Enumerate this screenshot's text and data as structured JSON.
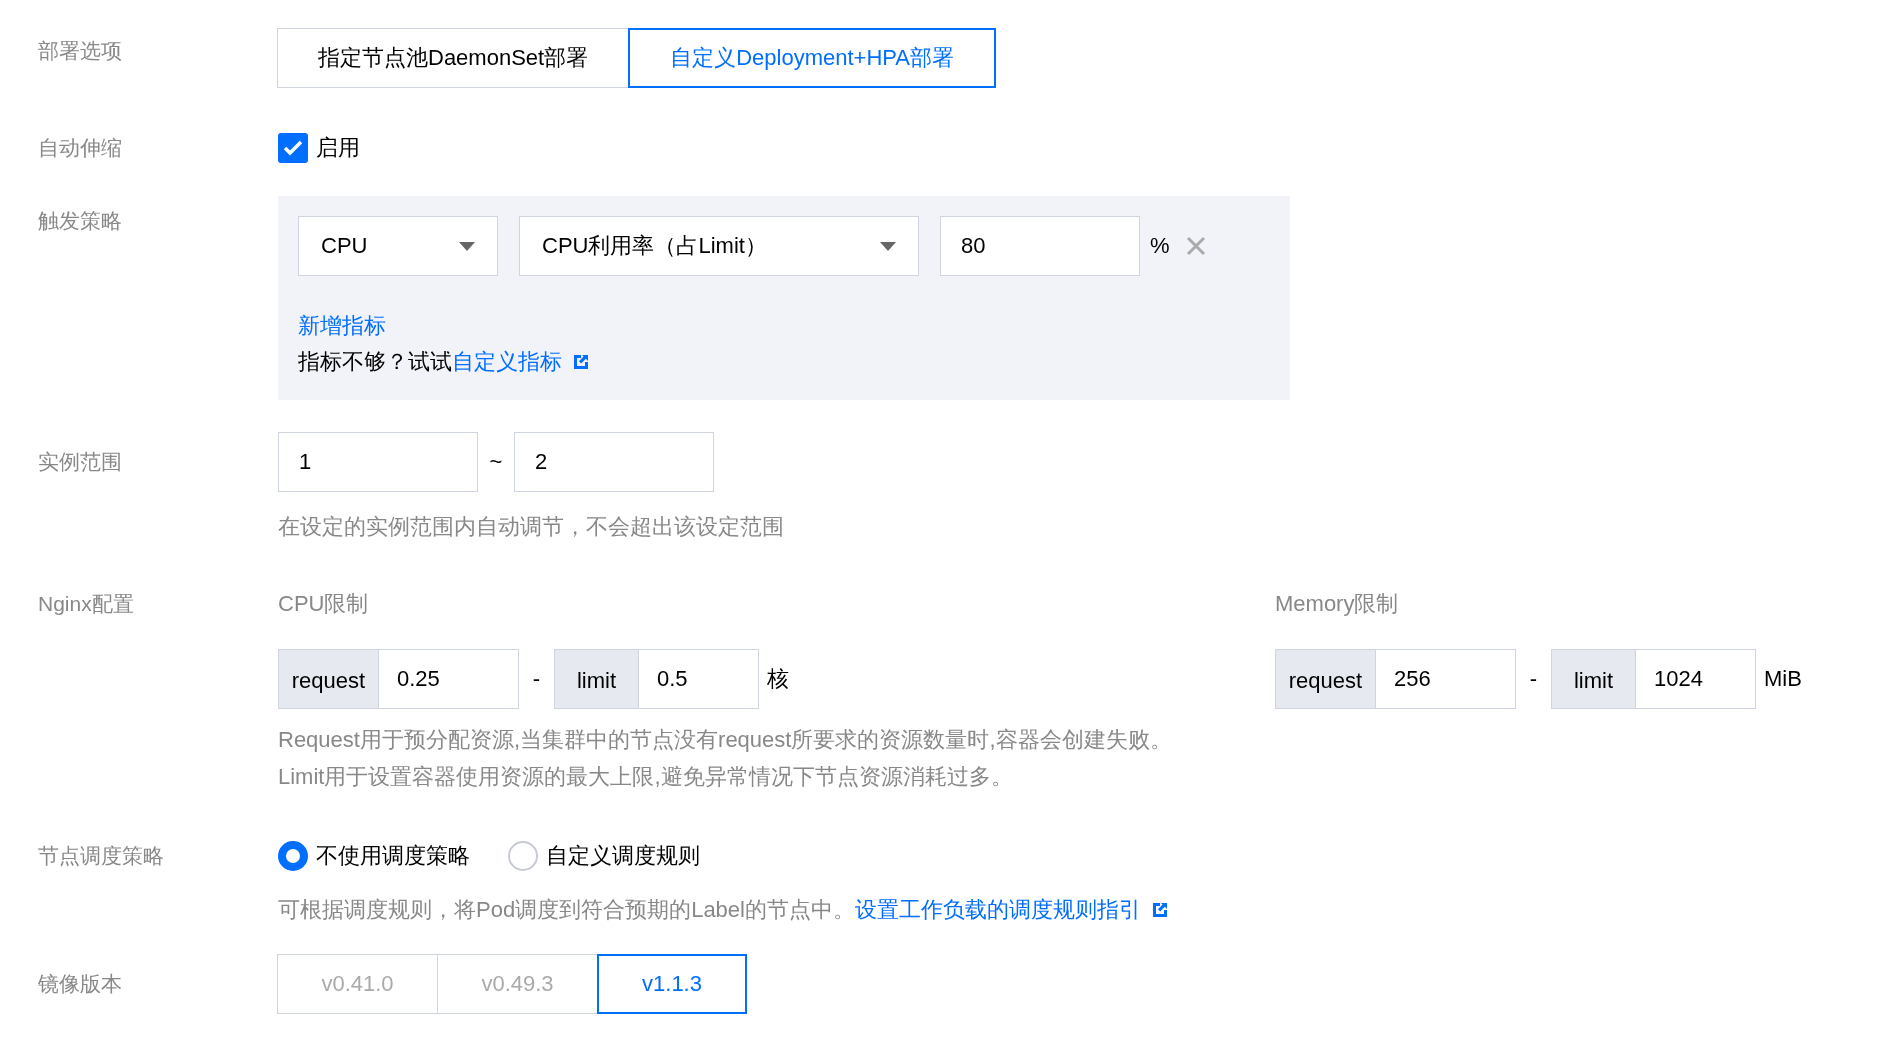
{
  "deploy_option": {
    "label": "部署选项",
    "options": [
      {
        "label": "指定节点池DaemonSet部署",
        "selected": false
      },
      {
        "label": "自定义Deployment+HPA部署",
        "selected": true
      }
    ]
  },
  "autoscaling": {
    "label": "自动伸缩",
    "checkbox": {
      "label": "启用",
      "checked": true
    }
  },
  "trigger_policy": {
    "label": "触发策略",
    "metric_type": {
      "value": "CPU"
    },
    "metric": {
      "value": "CPU利用率（占Limit）"
    },
    "threshold": {
      "value": "80"
    },
    "unit": "%",
    "add_link": "新增指标",
    "hint": "指标不够？试试",
    "hint_link": "自定义指标"
  },
  "instance_range": {
    "label": "实例范围",
    "min": {
      "value": "1"
    },
    "separator": "~",
    "max": {
      "value": "2"
    },
    "hint": "在设定的实例范围内自动调节，不会超出该设定范围"
  },
  "nginx_config": {
    "label": "Nginx配置",
    "groups": [
      {
        "title": "CPU限制",
        "request_label": "request",
        "request": "0.25",
        "separator": "-",
        "limit_label": "limit",
        "limit": "0.5",
        "unit": "核"
      },
      {
        "title": "Memory限制",
        "request_label": "request",
        "request": "256",
        "separator": "-",
        "limit_label": "limit",
        "limit": "1024",
        "unit": "MiB"
      }
    ],
    "hint_lines": [
      "Request用于预分配资源,当集群中的节点没有request所要求的资源数量时,容器会创建失败。",
      "Limit用于设置容器使用资源的最大上限,避免异常情况下节点资源消耗过多。"
    ]
  },
  "node_scheduling": {
    "label": "节点调度策略",
    "options": [
      {
        "label": "不使用调度策略",
        "selected": true
      },
      {
        "label": "自定义调度规则",
        "selected": false
      }
    ],
    "hint": "可根据调度规则，将Pod调度到符合预期的Label的节点中。",
    "hint_link": "设置工作负载的调度规则指引"
  },
  "image_version": {
    "label": "镜像版本",
    "options": [
      {
        "label": "v0.41.0",
        "selected": false
      },
      {
        "label": "v0.49.3",
        "selected": false
      },
      {
        "label": "v1.1.3",
        "selected": true
      }
    ]
  }
}
